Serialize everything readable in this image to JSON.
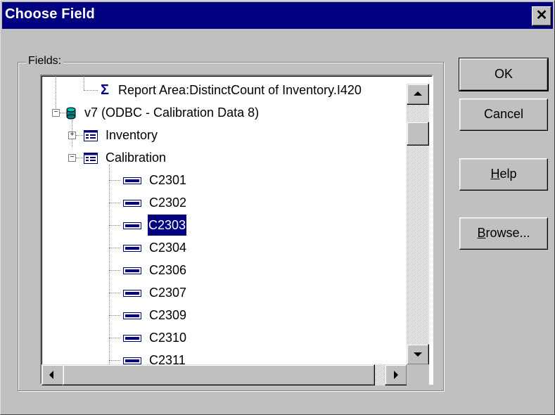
{
  "dialog": {
    "title": "Choose Field",
    "close_glyph": "✕",
    "group_label": "Fields:"
  },
  "tree": {
    "items": [
      {
        "label": "Report Area:DistinctCount of Inventory.I420",
        "icon": "sigma-icon"
      },
      {
        "label": "v7 (ODBC - Calibration Data 8)",
        "icon": "database-icon",
        "expander": "−"
      },
      {
        "label": "Inventory",
        "icon": "table-icon",
        "expander": "+"
      },
      {
        "label": "Calibration",
        "icon": "table-icon",
        "expander": "−"
      },
      {
        "label": "C2301",
        "icon": "field-icon"
      },
      {
        "label": "C2302",
        "icon": "field-icon"
      },
      {
        "label": "C2303",
        "icon": "field-icon",
        "selected": true
      },
      {
        "label": "C2304",
        "icon": "field-icon"
      },
      {
        "label": "C2306",
        "icon": "field-icon"
      },
      {
        "label": "C2307",
        "icon": "field-icon"
      },
      {
        "label": "C2309",
        "icon": "field-icon"
      },
      {
        "label": "C2310",
        "icon": "field-icon"
      },
      {
        "label": "C2311",
        "icon": "field-icon"
      }
    ],
    "selected": "C2303"
  },
  "buttons": {
    "ok": "OK",
    "cancel": "Cancel",
    "help_mnemonic": "H",
    "help_rest": "elp",
    "browse_mnemonic": "B",
    "browse_rest": "rowse..."
  },
  "colors": {
    "titlebar": "#000080",
    "face": "#c0c0c0",
    "selection": "#000080"
  }
}
